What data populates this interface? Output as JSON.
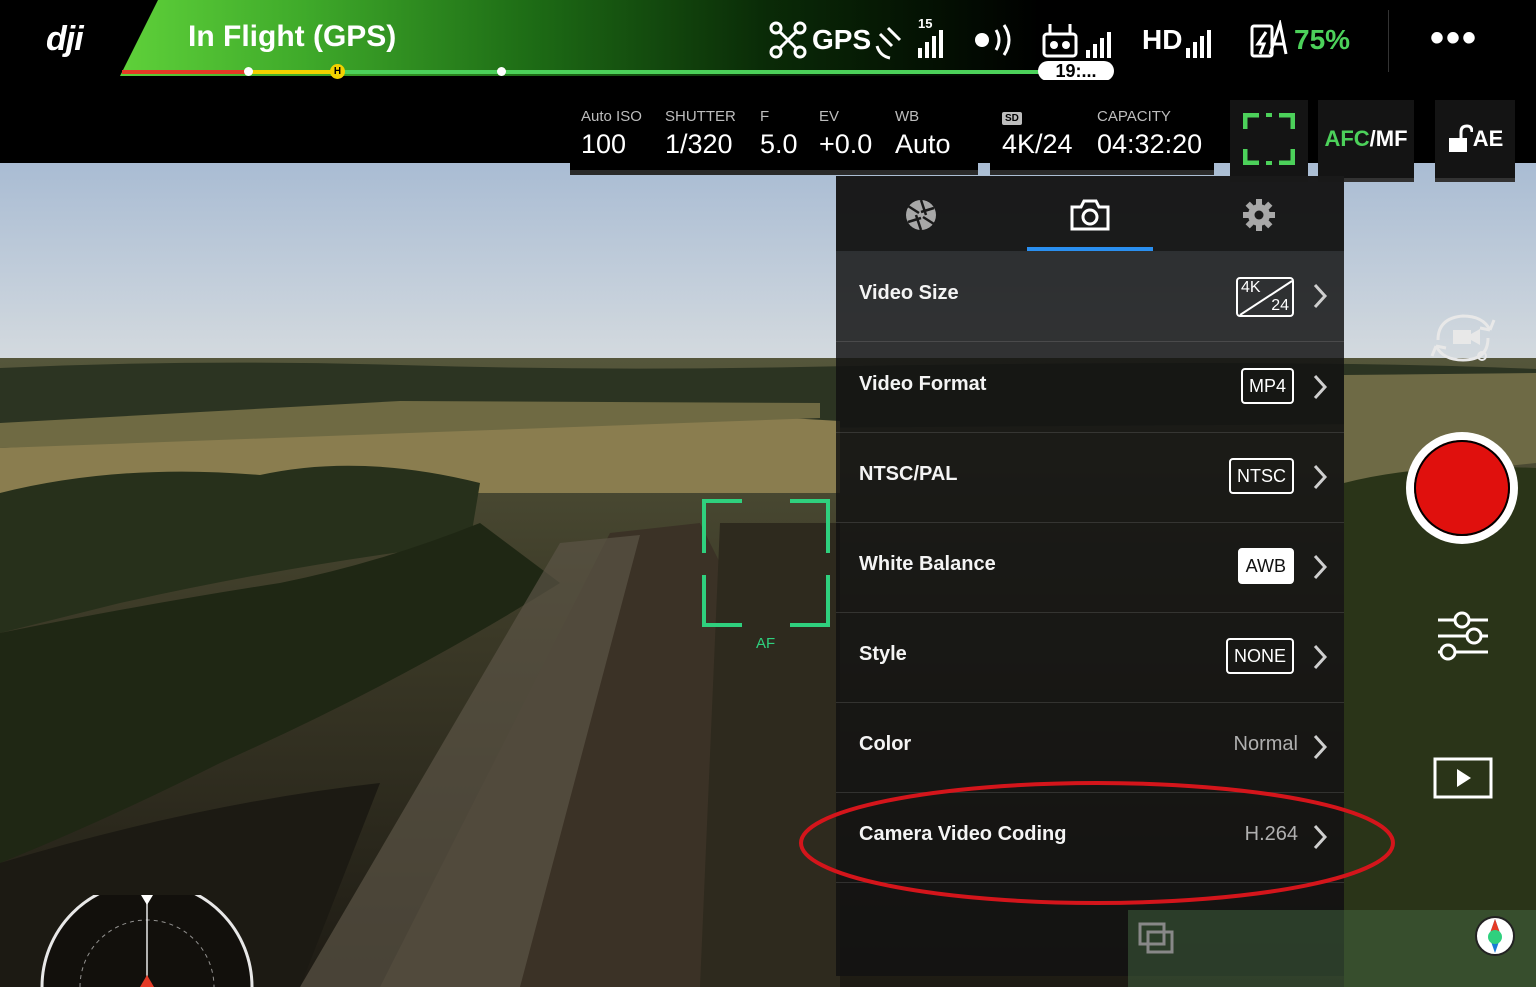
{
  "brand": {
    "logo_text": "dji"
  },
  "status": {
    "flight_mode": "In Flight (GPS)",
    "gps_label": "GPS",
    "satellite_count": "15",
    "transmission_label": "HD",
    "battery_percent": "75%",
    "flight_time": "19:...",
    "more_label": "•••"
  },
  "camera_params": {
    "iso_label": "Auto ISO",
    "iso_value": "100",
    "shutter_label": "SHUTTER",
    "shutter_value": "1/320",
    "f_label": "F",
    "f_value": "5.0",
    "ev_label": "EV",
    "ev_value": "+0.0",
    "wb_label": "WB",
    "wb_value": "Auto",
    "sd_label": "SD",
    "resolution_value": "4K/24",
    "capacity_label": "CAPACITY",
    "capacity_value": "04:32:20",
    "focus_mode_afc": "AFC",
    "focus_mode_slash": "/",
    "focus_mode_mf": "MF",
    "ae_lock_label": "AE"
  },
  "focus_box": {
    "label": "AF"
  },
  "settings_panel": {
    "tabs": [
      {
        "icon": "aperture-icon",
        "active": false
      },
      {
        "icon": "camera-icon",
        "active": true
      },
      {
        "icon": "gear-icon",
        "active": false
      }
    ],
    "rows": [
      {
        "label": "Video Size",
        "value_top": "4K",
        "value_bottom": "24",
        "style": "resolution-badge"
      },
      {
        "label": "Video Format",
        "value": "MP4",
        "style": "outline-badge"
      },
      {
        "label": "NTSC/PAL",
        "value": "NTSC",
        "style": "outline-badge"
      },
      {
        "label": "White Balance",
        "value": "AWB",
        "style": "filled-badge"
      },
      {
        "label": "Style",
        "value": "NONE",
        "style": "outline-badge"
      },
      {
        "label": "Color",
        "value": "Normal",
        "style": "text"
      },
      {
        "label": "Camera Video Coding",
        "value": "H.264",
        "style": "text",
        "highlighted": true
      }
    ]
  },
  "colors": {
    "accent_green": "#4cd15a",
    "focus_green": "#2fd07e",
    "tab_active": "#2a8ff0",
    "record_red": "#e0100d",
    "annotation_red": "#d4151b"
  }
}
